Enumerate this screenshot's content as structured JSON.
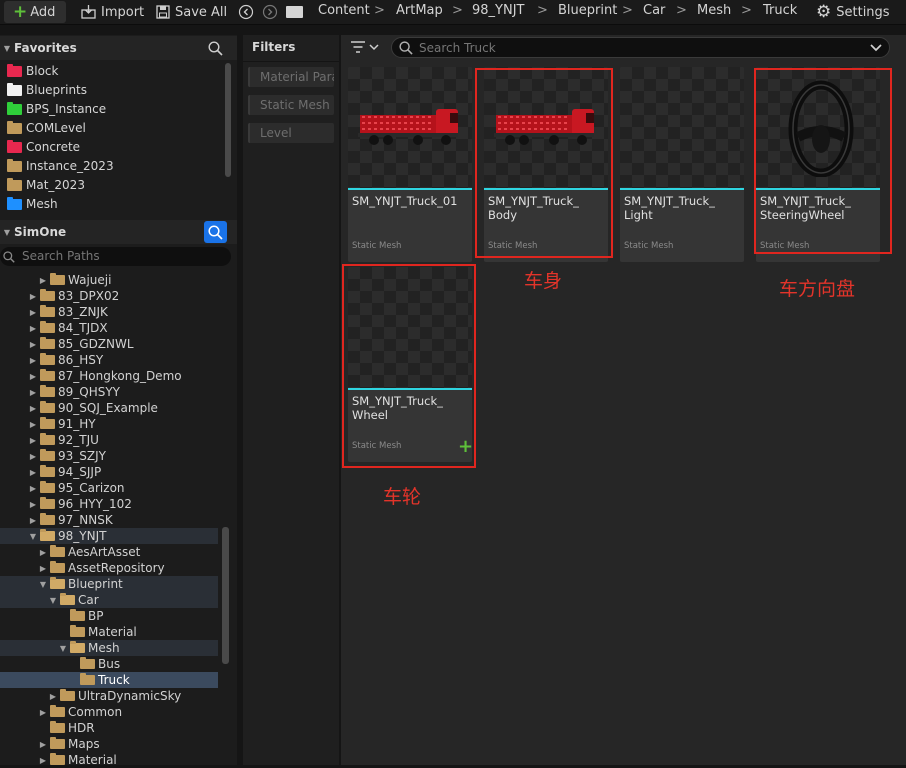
{
  "toolbar": {
    "add_label": "Add",
    "import_label": "Import",
    "save_all_label": "Save All",
    "settings_label": "Settings",
    "breadcrumbs": [
      "Content",
      "ArtMap",
      "98_YNJT",
      "Blueprint",
      "Car",
      "Mesh",
      "Truck"
    ]
  },
  "favorites": {
    "title": "Favorites",
    "items": [
      {
        "label": "Block",
        "color": "#e8284f"
      },
      {
        "label": "Blueprints",
        "color": "#f2f2f2"
      },
      {
        "label": "BPS_Instance",
        "color": "#2fcf3a"
      },
      {
        "label": "COMLevel",
        "color": "#c09a5b"
      },
      {
        "label": "Concrete",
        "color": "#e8284f"
      },
      {
        "label": "Instance_2023",
        "color": "#c09a5b"
      },
      {
        "label": "Mat_2023",
        "color": "#c09a5b"
      },
      {
        "label": "Mesh",
        "color": "#1e90ff"
      }
    ]
  },
  "project": {
    "title": "SimOne",
    "search_placeholder": "Search Paths",
    "tree": [
      {
        "label": "Wajueji",
        "indent": 2,
        "open": false
      },
      {
        "label": "83_DPX02",
        "indent": 1,
        "open": false
      },
      {
        "label": "83_ZNJK",
        "indent": 1,
        "open": false
      },
      {
        "label": "84_TJDX",
        "indent": 1,
        "open": false
      },
      {
        "label": "85_GDZNWL",
        "indent": 1,
        "open": false
      },
      {
        "label": "86_HSY",
        "indent": 1,
        "open": false
      },
      {
        "label": "87_Hongkong_Demo",
        "indent": 1,
        "open": false
      },
      {
        "label": "89_QHSYY",
        "indent": 1,
        "open": false
      },
      {
        "label": "90_SQJ_Example",
        "indent": 1,
        "open": false
      },
      {
        "label": "91_HY",
        "indent": 1,
        "open": false
      },
      {
        "label": "92_TJU",
        "indent": 1,
        "open": false
      },
      {
        "label": "93_SZJY",
        "indent": 1,
        "open": false
      },
      {
        "label": "94_SJJP",
        "indent": 1,
        "open": false
      },
      {
        "label": "95_Carizon",
        "indent": 1,
        "open": false
      },
      {
        "label": "96_HYY_102",
        "indent": 1,
        "open": false
      },
      {
        "label": "97_NNSK",
        "indent": 1,
        "open": false
      },
      {
        "label": "98_YNJT",
        "indent": 1,
        "open": true,
        "hl": true
      },
      {
        "label": "AesArtAsset",
        "indent": 2,
        "open": false
      },
      {
        "label": "AssetRepository",
        "indent": 2,
        "open": false
      },
      {
        "label": "Blueprint",
        "indent": 2,
        "open": true,
        "hl": true
      },
      {
        "label": "Car",
        "indent": 3,
        "open": true,
        "hl": true
      },
      {
        "label": "BP",
        "indent": 4,
        "leaf": true
      },
      {
        "label": "Material",
        "indent": 4,
        "leaf": true
      },
      {
        "label": "Mesh",
        "indent": 4,
        "open": true,
        "hl": true,
        "small": true
      },
      {
        "label": "Bus",
        "indent": 5,
        "leaf": true
      },
      {
        "label": "Truck",
        "indent": 5,
        "leaf": true,
        "sel": true
      },
      {
        "label": "UltraDynamicSky",
        "indent": 3,
        "open": false
      },
      {
        "label": "Common",
        "indent": 2,
        "open": false
      },
      {
        "label": "HDR",
        "indent": 2,
        "leaf": true
      },
      {
        "label": "Maps",
        "indent": 2,
        "open": false
      },
      {
        "label": "Material",
        "indent": 2,
        "open": false
      }
    ]
  },
  "filters": {
    "title": "Filters",
    "chips": [
      "Material Parameter Collection",
      "Static Mesh",
      "Level"
    ]
  },
  "content": {
    "search_placeholder": "Search Truck",
    "assets": [
      {
        "name": "SM_YNJT_Truck_01",
        "type": "Static Mesh",
        "thumb": "truck"
      },
      {
        "name": "SM_YNJT_Truck_\nBody",
        "type": "Static Mesh",
        "thumb": "truck"
      },
      {
        "name": "SM_YNJT_Truck_\nLight",
        "type": "Static Mesh",
        "thumb": "empty"
      },
      {
        "name": "SM_YNJT_Truck_\nSteeringWheel",
        "type": "Static Mesh",
        "thumb": "wheel"
      },
      {
        "name": "SM_YNJT_Truck_\nWheel",
        "type": "Static Mesh",
        "thumb": "empty"
      }
    ]
  },
  "annotations": {
    "body": "车身",
    "steering": "车方向盘",
    "wheel": "车轮"
  }
}
